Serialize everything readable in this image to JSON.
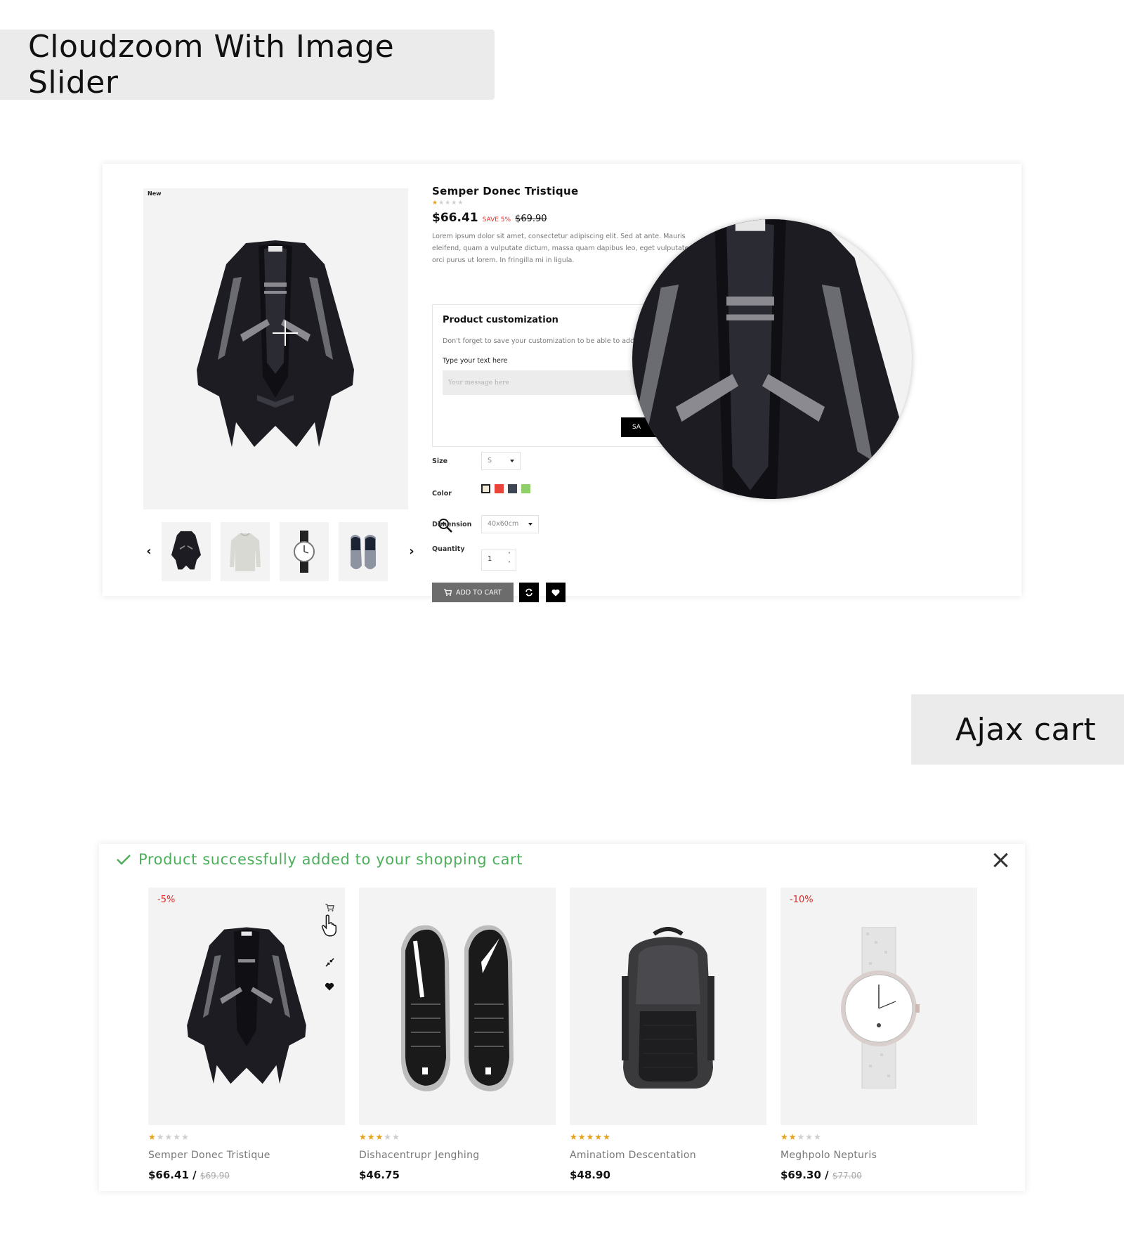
{
  "banners": {
    "cloudzoom": "Cloudzoom With Image Slider",
    "ajax_cart": "Ajax cart"
  },
  "product": {
    "badge": "New",
    "title": "Semper Donec Tristique",
    "rating": 1,
    "rating_max": 5,
    "price": "$66.41",
    "save": "SAVE 5%",
    "old_price": "$69.90",
    "description": "Lorem ipsum dolor sit amet, consectetur adipiscing elit. Sed at ante. Mauris eleifend, quam a vulputate dictum, massa quam dapibus leo, eget vulputate orci purus ut lorem. In fringilla mi in ligula.",
    "customization": {
      "heading": "Product customization",
      "note": "Don't forget to save your customization to be able to add to cart",
      "field_label": "Type your text here",
      "placeholder": "Your message here",
      "save_label": "SA"
    },
    "options": {
      "size_label": "Size",
      "size_value": "S",
      "color_label": "Color",
      "colors": [
        "#f2ead8",
        "#e8443a",
        "#3e4653",
        "#8fcf6a"
      ],
      "dimension_label": "Dimension",
      "dimension_value": "40x60cm",
      "quantity_label": "Quantity",
      "quantity_value": "1"
    },
    "add_to_cart": "ADD TO CART",
    "thumbnails": [
      "cape-icon",
      "sweater-icon",
      "watch-icon",
      "sneakers-icon"
    ]
  },
  "cart_modal": {
    "message": "Product successfully added to your shopping cart",
    "products": [
      {
        "name": "Semper Donec Tristique",
        "rating": 1,
        "price": "$66.41",
        "sep": "/",
        "old_price": "$69.90",
        "discount": "-5%"
      },
      {
        "name": "Dishacentrupr Jenghing",
        "rating": 3,
        "price": "$46.75",
        "sep": "",
        "old_price": "",
        "discount": ""
      },
      {
        "name": "Aminatiom Descentation",
        "rating": 5,
        "price": "$48.90",
        "sep": "",
        "old_price": "",
        "discount": ""
      },
      {
        "name": "Meghpolo Nepturis",
        "rating": 2,
        "price": "$69.30",
        "sep": "/",
        "old_price": "$77.00",
        "discount": "-10%"
      }
    ]
  },
  "colors": {
    "success": "#4cae5b",
    "sale": "#e02b2b",
    "star": "#e8a21a",
    "cart_button": "#6c6c6c"
  }
}
